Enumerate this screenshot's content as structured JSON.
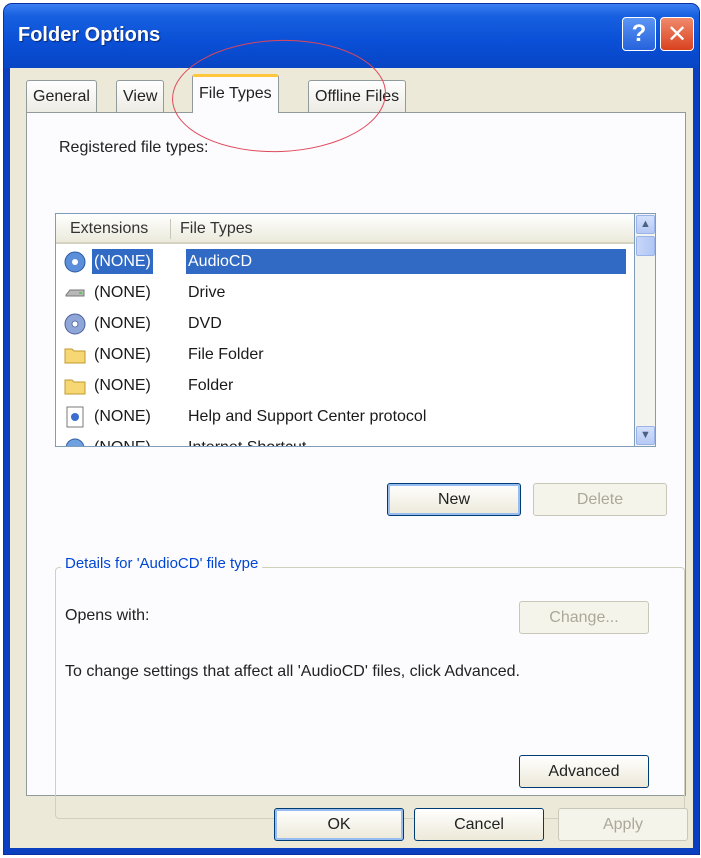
{
  "window": {
    "title": "Folder Options"
  },
  "titlebar_buttons": {
    "help": "?",
    "close": "✕"
  },
  "tabs": [
    {
      "label": "General"
    },
    {
      "label": "View"
    },
    {
      "label": "File Types"
    },
    {
      "label": "Offline Files"
    }
  ],
  "active_tab": "File Types",
  "registered_label": "Registered file types:",
  "list": {
    "columns": {
      "extensions": "Extensions",
      "file_types": "File Types"
    },
    "rows": [
      {
        "ext": "(NONE)",
        "type": "AudioCD",
        "icon": "audiocd-icon",
        "selected": true
      },
      {
        "ext": "(NONE)",
        "type": "Drive",
        "icon": "drive-icon"
      },
      {
        "ext": "(NONE)",
        "type": "DVD",
        "icon": "dvd-icon"
      },
      {
        "ext": "(NONE)",
        "type": "File Folder",
        "icon": "folder-icon"
      },
      {
        "ext": "(NONE)",
        "type": "Folder",
        "icon": "folder-icon"
      },
      {
        "ext": "(NONE)",
        "type": "Help and Support Center protocol",
        "icon": "help-protocol-icon"
      },
      {
        "ext": "(NONE)",
        "type": "Internet Shortcut",
        "icon": "internet-shortcut-icon"
      }
    ]
  },
  "buttons": {
    "new": "New",
    "delete": "Delete",
    "change": "Change...",
    "advanced": "Advanced",
    "ok": "OK",
    "cancel": "Cancel",
    "apply": "Apply"
  },
  "details": {
    "title": "Details for 'AudioCD' file type",
    "opens_with_label": "Opens with:",
    "info_text": "To change settings that affect all 'AudioCD' files, click Advanced."
  },
  "colors": {
    "title_bar": "#0a4fd6",
    "selection": "#316ac5",
    "active_tab_accent": "#ffc83c",
    "annotation_circle": "#e0475a",
    "group_title": "#0046d5"
  }
}
